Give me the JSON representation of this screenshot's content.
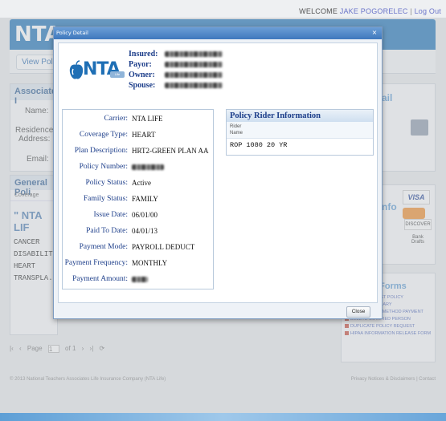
{
  "header": {
    "welcome_prefix": "WELCOME",
    "user_name": "JAKE POGORELEC",
    "separator": "|",
    "logout": "Log Out"
  },
  "background": {
    "logo_text": "NTA",
    "view_policy_tab": "View Policy",
    "associate_title": "Associate I",
    "name_label": "Name:",
    "residence_label": "Residence",
    "address_label": "Address:",
    "email_label": "Email:",
    "general_title": "General Poli",
    "coverage_col": "Coverage",
    "nta_life": "NTA LIF",
    "coverages": [
      "CANCER",
      "DISABILITY",
      "HEART",
      "TRANSPLA..."
    ],
    "pager": {
      "page_label": "Page",
      "page_value": "1",
      "of_label": "of 1"
    },
    "email_panel_title": "ail",
    "payment_panel_title": "nfo",
    "visa": "VISA",
    "discover": "DISCOVER",
    "bank_drafts": "Bank Drafts",
    "forms_title": "y Forms",
    "forms": [
      "LOST POLICY",
      "FICIARY",
      "OR METHOD PAYMENT",
      "DELETE COVERED PERSON",
      "DUPLICATE POLICY REQUEST",
      "HIPAA INFORMATION RELEASE FORM"
    ],
    "footer_left": "© 2013 National Teachers Associates Life Insurance Company (NTA Life)",
    "footer_right": "Privacy Notices & Disclaimers | Contact"
  },
  "dialog": {
    "title": "Policy Detail",
    "close_glyph": "×",
    "logo_text": "NTA",
    "logo_sub": "Life",
    "parties": [
      {
        "label": "Insured:"
      },
      {
        "label": "Payor:"
      },
      {
        "label": "Owner:"
      },
      {
        "label": "Spouse:"
      }
    ],
    "details": [
      {
        "label": "Carrier:",
        "value": "NTA LIFE"
      },
      {
        "label": "Coverage Type:",
        "value": "HEART"
      },
      {
        "label": "Plan Description:",
        "value": "HRT2-GREEN PLAN AA"
      },
      {
        "label": "Policy Number:",
        "value": ""
      },
      {
        "label": "Policy Status:",
        "value": "Active"
      },
      {
        "label": "Family Status:",
        "value": "FAMILY"
      },
      {
        "label": "Issue Date:",
        "value": "06/01/00"
      },
      {
        "label": "Paid To Date:",
        "value": "04/01/13"
      },
      {
        "label": "Payment Mode:",
        "value": "PAYROLL DEDUCT"
      },
      {
        "label": "Payment Frequency:",
        "value": "MONTHLY"
      },
      {
        "label": "Payment Amount:",
        "value": ""
      }
    ],
    "rider": {
      "title": "Policy Rider Information",
      "col_line1": "Rider",
      "col_line2": "Name",
      "rows": [
        "ROP 1080 20 YR"
      ]
    },
    "close_button": "Close"
  },
  "colors": {
    "accent": "#1e73b9",
    "label_blue": "#1d3e8a",
    "title_bar": "#3e78bd"
  }
}
